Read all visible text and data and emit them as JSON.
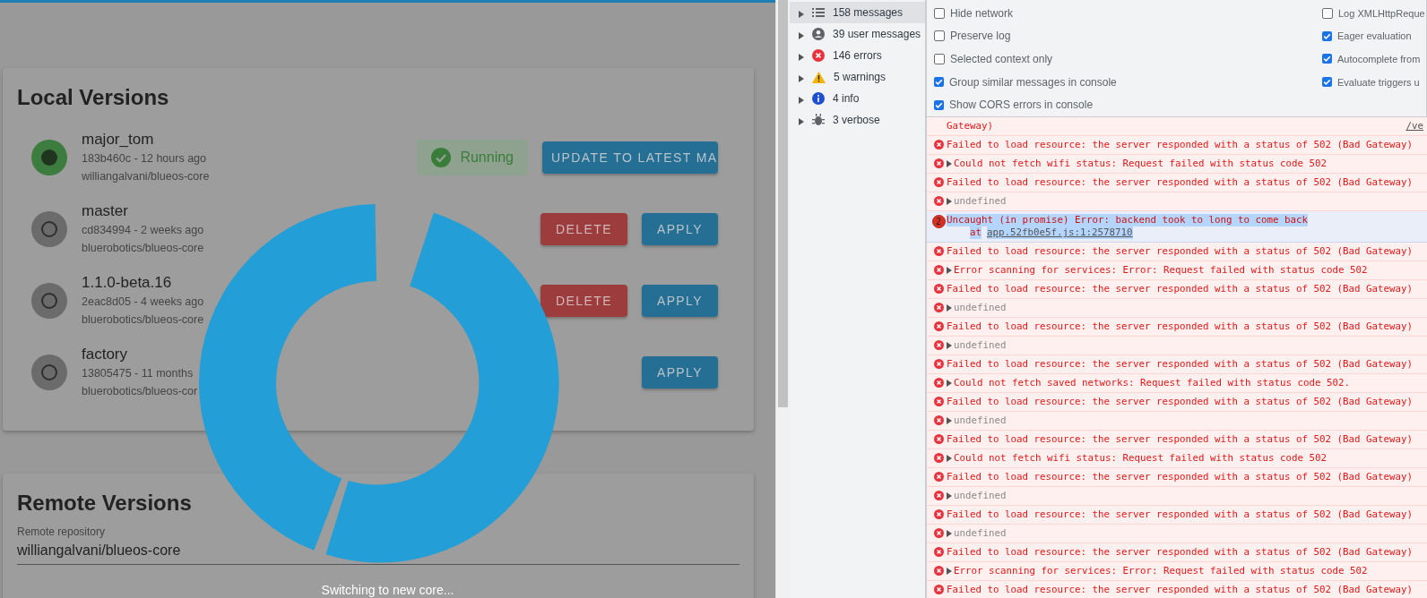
{
  "app": {
    "local_versions": {
      "title": "Local Versions",
      "versions": [
        {
          "name": "major_tom",
          "detail": "183b460c - 12 hours ago",
          "repo": "williangalvani/blueos-core",
          "selected": true,
          "status": "Running",
          "actions": [
            {
              "label": "UPDATE TO LATEST MA",
              "kind": "update"
            }
          ]
        },
        {
          "name": "master",
          "detail": "cd834994 - 2 weeks ago",
          "repo": "bluerobotics/blueos-core",
          "selected": false,
          "actions": [
            {
              "label": "DELETE",
              "kind": "delete"
            },
            {
              "label": "APPLY",
              "kind": "apply"
            }
          ]
        },
        {
          "name": "1.1.0-beta.16",
          "detail": "2eac8d05 - 4 weeks ago",
          "repo": "bluerobotics/blueos-core",
          "selected": false,
          "actions": [
            {
              "label": "DELETE",
              "kind": "delete"
            },
            {
              "label": "APPLY",
              "kind": "apply"
            }
          ]
        },
        {
          "name": "factory",
          "detail": "13805475 - 11 months",
          "repo": "bluerobotics/blueos-cor",
          "selected": false,
          "actions": [
            {
              "label": "APPLY",
              "kind": "apply"
            }
          ]
        }
      ]
    },
    "remote_versions": {
      "title": "Remote Versions",
      "field": {
        "label": "Remote repository",
        "value": "williangalvani/blueos-core"
      }
    },
    "overlay": {
      "message": "Switching to new core..."
    }
  },
  "devtools": {
    "sidebar": {
      "items": [
        {
          "label": "158 messages",
          "kind": "all",
          "selected": true
        },
        {
          "label": "39 user messages",
          "kind": "user",
          "selected": false
        },
        {
          "label": "146 errors",
          "kind": "error",
          "selected": false
        },
        {
          "label": "5 warnings",
          "kind": "warning",
          "selected": false
        },
        {
          "label": "4 info",
          "kind": "info",
          "selected": false
        },
        {
          "label": "3 verbose",
          "kind": "verbose",
          "selected": false
        }
      ]
    },
    "settings": {
      "left": [
        {
          "label": "Hide network",
          "checked": false
        },
        {
          "label": "Preserve log",
          "checked": false
        },
        {
          "label": "Selected context only",
          "checked": false
        },
        {
          "label": "Group similar messages in console",
          "checked": true
        },
        {
          "label": "Show CORS errors in console",
          "checked": true
        }
      ],
      "right": [
        {
          "label": "Log XMLHttpReque",
          "checked": false
        },
        {
          "label": "Eager evaluation",
          "checked": true
        },
        {
          "label": "Autocomplete from",
          "checked": true
        },
        {
          "label": "Evaluate triggers u",
          "checked": true
        }
      ]
    },
    "console": [
      {
        "kind": "cut",
        "text": "Gateway)",
        "link": "/ve"
      },
      {
        "kind": "error",
        "text": "Failed to load resource: the server responded with a status of 502 (Bad Gateway)"
      },
      {
        "kind": "expandable",
        "text": "Could not fetch wifi status: Request failed with status code 502"
      },
      {
        "kind": "error",
        "text": "Failed to load resource: the server responded with a status of 502 (Bad Gateway)"
      },
      {
        "kind": "undefined",
        "text": "undefined"
      },
      {
        "kind": "uncaught",
        "count": "2",
        "text": "Uncaught (in promise) Error: backend took to long to come back",
        "prefix": "at",
        "link": "app.52fb0e5f.js:1:2578710",
        "highlighted": true
      },
      {
        "kind": "error",
        "text": "Failed to load resource: the server responded with a status of 502 (Bad Gateway)"
      },
      {
        "kind": "expandable",
        "text": "Error scanning for services: Error: Request failed with status code 502"
      },
      {
        "kind": "error",
        "text": "Failed to load resource: the server responded with a status of 502 (Bad Gateway)"
      },
      {
        "kind": "undefined",
        "text": "undefined"
      },
      {
        "kind": "error",
        "text": "Failed to load resource: the server responded with a status of 502 (Bad Gateway)"
      },
      {
        "kind": "undefined",
        "text": "undefined"
      },
      {
        "kind": "error",
        "text": "Failed to load resource: the server responded with a status of 502 (Bad Gateway)"
      },
      {
        "kind": "expandable",
        "text": "Could not fetch saved networks: Request failed with status code 502."
      },
      {
        "kind": "error",
        "text": "Failed to load resource: the server responded with a status of 502 (Bad Gateway)"
      },
      {
        "kind": "undefined",
        "text": "undefined"
      },
      {
        "kind": "error",
        "text": "Failed to load resource: the server responded with a status of 502 (Bad Gateway)"
      },
      {
        "kind": "expandable",
        "text": "Could not fetch wifi status: Request failed with status code 502"
      },
      {
        "kind": "error",
        "text": "Failed to load resource: the server responded with a status of 502 (Bad Gateway)"
      },
      {
        "kind": "undefined",
        "text": "undefined"
      },
      {
        "kind": "error",
        "text": "Failed to load resource: the server responded with a status of 502 (Bad Gateway)"
      },
      {
        "kind": "undefined",
        "text": "undefined"
      },
      {
        "kind": "error",
        "text": "Failed to load resource: the server responded with a status of 502 (Bad Gateway)"
      },
      {
        "kind": "expandable",
        "text": "Error scanning for services: Error: Request failed with status code 502"
      },
      {
        "kind": "error",
        "text": "Failed to load resource: the server responded with a status of 502 (Bad Gateway)"
      }
    ]
  }
}
